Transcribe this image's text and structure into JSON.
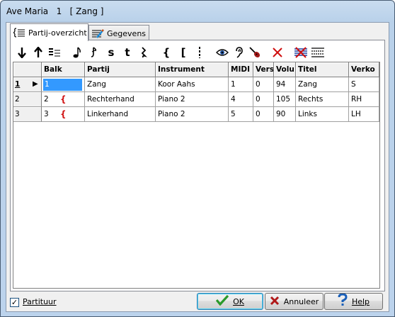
{
  "window": {
    "title": "Ave Maria   1   [ Zang ]"
  },
  "tabs": [
    {
      "label": "Partij-overzicht",
      "icon": "list-brace-icon",
      "active": true
    },
    {
      "label": "Gegevens",
      "icon": "staff-pencil-icon",
      "active": false
    }
  ],
  "toolbar": {
    "items": [
      {
        "name": "move-down-arrow-icon",
        "glyph": "↓"
      },
      {
        "name": "move-up-arrow-icon",
        "glyph": "↑"
      },
      {
        "name": "list-lines-icon",
        "glyph": "≡"
      },
      {
        "name": "eighth-note-icon",
        "glyph": "♪"
      },
      {
        "name": "grace-note-icon",
        "glyph": "ȷ"
      },
      {
        "name": "s-toggle-icon",
        "glyph": "s"
      },
      {
        "name": "t-toggle-icon",
        "glyph": "t"
      },
      {
        "name": "rest-icon",
        "glyph": "𝄽"
      },
      {
        "name": "brace-icon",
        "glyph": "{"
      },
      {
        "name": "bracket-icon",
        "glyph": "["
      },
      {
        "name": "dotted-barline-icon",
        "glyph": "¦"
      },
      {
        "name": "eye-icon",
        "glyph": "◉"
      },
      {
        "name": "ear-icon",
        "glyph": "∂"
      },
      {
        "name": "instrument-icon",
        "glyph": "♦"
      },
      {
        "name": "delete-x-icon",
        "glyph": "✕"
      },
      {
        "name": "strike-staff-icon",
        "glyph": "≢"
      },
      {
        "name": "staff-lines-icon",
        "glyph": "☰"
      }
    ]
  },
  "grid": {
    "headers": [
      "",
      "Balk",
      "Partij",
      "Instrument",
      "MIDI",
      "Vers",
      "Volu",
      "Titel",
      "Verko"
    ],
    "rows": [
      {
        "num": "1",
        "current": true,
        "balk": "1",
        "brace": "",
        "partij": "Zang",
        "instrument": "Koor Aahs",
        "midi": "1",
        "vers": "0",
        "volu": "94",
        "titel": "Zang",
        "verko": "S"
      },
      {
        "num": "2",
        "current": false,
        "balk": "2",
        "brace": "{",
        "partij": "Rechterhand",
        "instrument": "Piano 2",
        "midi": "4",
        "vers": "0",
        "volu": "105",
        "titel": "Rechts",
        "verko": "RH"
      },
      {
        "num": "3",
        "current": false,
        "balk": "3",
        "brace": "{",
        "partij": "Linkerhand",
        "instrument": "Piano 2",
        "midi": "5",
        "vers": "0",
        "volu": "90",
        "titel": "Links",
        "verko": "LH"
      }
    ]
  },
  "footer": {
    "partituur_label": "Partituur",
    "partituur_checked": "✓",
    "ok_label": "OK",
    "annuleer_label": "Annuleer",
    "help_label": "Help"
  },
  "colors": {
    "selection": "#3399ff",
    "brace_red": "#d01010",
    "ok_green": "#2a9a2a",
    "cancel_red": "#b01818",
    "help_blue": "#1a5fb8"
  }
}
